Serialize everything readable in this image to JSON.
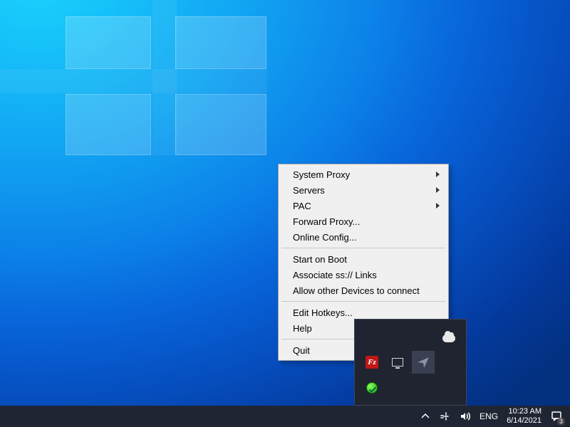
{
  "context_menu": {
    "groups": [
      [
        {
          "label": "System Proxy",
          "submenu": true
        },
        {
          "label": "Servers",
          "submenu": true
        },
        {
          "label": "PAC",
          "submenu": true
        },
        {
          "label": "Forward Proxy...",
          "submenu": false
        },
        {
          "label": "Online Config...",
          "submenu": false
        }
      ],
      [
        {
          "label": "Start on Boot",
          "submenu": false
        },
        {
          "label": "Associate ss:// Links",
          "submenu": false
        },
        {
          "label": "Allow other Devices to connect",
          "submenu": false
        }
      ],
      [
        {
          "label": "Edit Hotkeys...",
          "submenu": false
        },
        {
          "label": "Help",
          "submenu": true
        }
      ],
      [
        {
          "label": "Quit",
          "submenu": false
        }
      ]
    ]
  },
  "tray_flyout": {
    "icons": [
      {
        "name": "cloud-icon",
        "kind": "cloud"
      },
      {
        "name": "placeholder1",
        "kind": ""
      },
      {
        "name": "placeholder2",
        "kind": ""
      },
      {
        "name": "placeholder3",
        "kind": ""
      },
      {
        "name": "filezilla-icon",
        "kind": "fz"
      },
      {
        "name": "display-icon",
        "kind": "mon"
      },
      {
        "name": "shadowsocks-icon",
        "kind": "plane"
      },
      {
        "name": "placeholder4",
        "kind": ""
      },
      {
        "name": "green-status-icon",
        "kind": "green"
      },
      {
        "name": "placeholder5",
        "kind": ""
      },
      {
        "name": "placeholder6",
        "kind": ""
      },
      {
        "name": "placeholder7",
        "kind": ""
      }
    ]
  },
  "taskbar": {
    "language": "ENG",
    "time": "10:23 AM",
    "date": "6/14/2021",
    "action_center_badge": "3"
  }
}
